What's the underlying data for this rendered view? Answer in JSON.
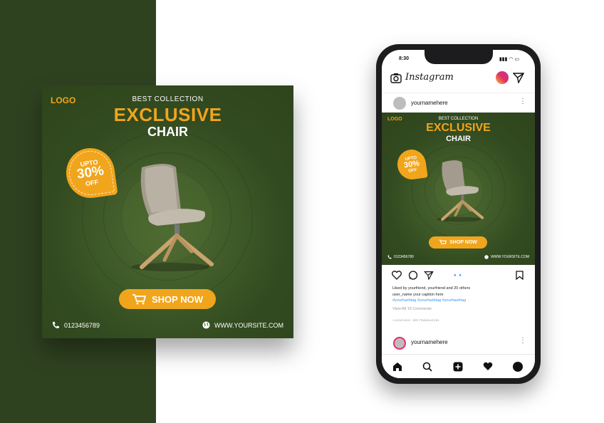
{
  "post": {
    "logo": "LOGO",
    "kicker": "BEST COLLECTION",
    "title": "EXCLUSIVE",
    "subtitle": "CHAIR",
    "badge": {
      "line1": "UPTO",
      "line2": "30%",
      "line3": "OFF"
    },
    "cta": "SHOP NOW",
    "phone": "0123456789",
    "website": "WWW.YOURSITE.COM"
  },
  "mini_post": {
    "phone": "0123456789",
    "website": "WWW.YOURSITE.COM"
  },
  "phone_ui": {
    "time": "8:30",
    "status": "▮▮▮ ◠ ▭",
    "app_title": "Instagram",
    "username": "yournamehere",
    "pager": "● ●",
    "likes": "Liked by yourfriend, yourfriend and 20 others",
    "caption": "user_name  your caption here",
    "hashtags": "#yourhashtag #yourhashtag #yourhashtag",
    "comments": "View All 10 Comments",
    "translation": "1 HOUR AGO · SEE TRANSLATION",
    "username2": "yournamehere"
  },
  "colors": {
    "panel": "#2f4220",
    "accent": "#f1a51c",
    "post_bg": "#3f5a28"
  },
  "icons": [
    "phone-icon",
    "globe-icon",
    "cart-icon",
    "camera-icon",
    "send-icon",
    "heart-icon",
    "comment-icon",
    "bookmark-icon",
    "home-icon",
    "search-icon",
    "plus-icon"
  ]
}
